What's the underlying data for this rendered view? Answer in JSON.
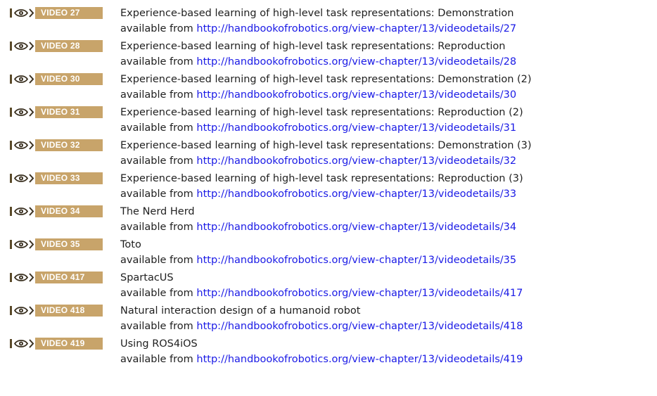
{
  "prefix": "available from",
  "badge_color": "#c8a46a",
  "link_color": "#1a1ae6",
  "badge_icon": "eye-icon",
  "entries": [
    {
      "badge": "VIDEO 27",
      "title": "Experience-based learning of high-level task representations: Demonstration",
      "url": "http://handbookofrobotics.org/view-chapter/13/videodetails/27"
    },
    {
      "badge": "VIDEO 28",
      "title": "Experience-based learning of high-level task representations: Reproduction",
      "url": "http://handbookofrobotics.org/view-chapter/13/videodetails/28"
    },
    {
      "badge": "VIDEO 30",
      "title": "Experience-based learning of high-level task representations: Demonstration (2)",
      "url": "http://handbookofrobotics.org/view-chapter/13/videodetails/30"
    },
    {
      "badge": "VIDEO 31",
      "title": "Experience-based learning of high-level task representations: Reproduction (2)",
      "url": "http://handbookofrobotics.org/view-chapter/13/videodetails/31"
    },
    {
      "badge": "VIDEO 32",
      "title": "Experience-based learning of high-level task representations: Demonstration (3)",
      "url": "http://handbookofrobotics.org/view-chapter/13/videodetails/32"
    },
    {
      "badge": "VIDEO 33",
      "title": "Experience-based learning of high-level task representations: Reproduction (3)",
      "url": "http://handbookofrobotics.org/view-chapter/13/videodetails/33"
    },
    {
      "badge": "VIDEO 34",
      "title": "The Nerd Herd",
      "url": "http://handbookofrobotics.org/view-chapter/13/videodetails/34"
    },
    {
      "badge": "VIDEO 35",
      "title": "Toto",
      "url": "http://handbookofrobotics.org/view-chapter/13/videodetails/35"
    },
    {
      "badge": "VIDEO 417",
      "title": "SpartacUS",
      "url": "http://handbookofrobotics.org/view-chapter/13/videodetails/417"
    },
    {
      "badge": "VIDEO 418",
      "title": "Natural interaction design of a humanoid robot",
      "url": "http://handbookofrobotics.org/view-chapter/13/videodetails/418"
    },
    {
      "badge": "VIDEO 419",
      "title": "Using ROS4iOS",
      "url": "http://handbookofrobotics.org/view-chapter/13/videodetails/419"
    }
  ]
}
